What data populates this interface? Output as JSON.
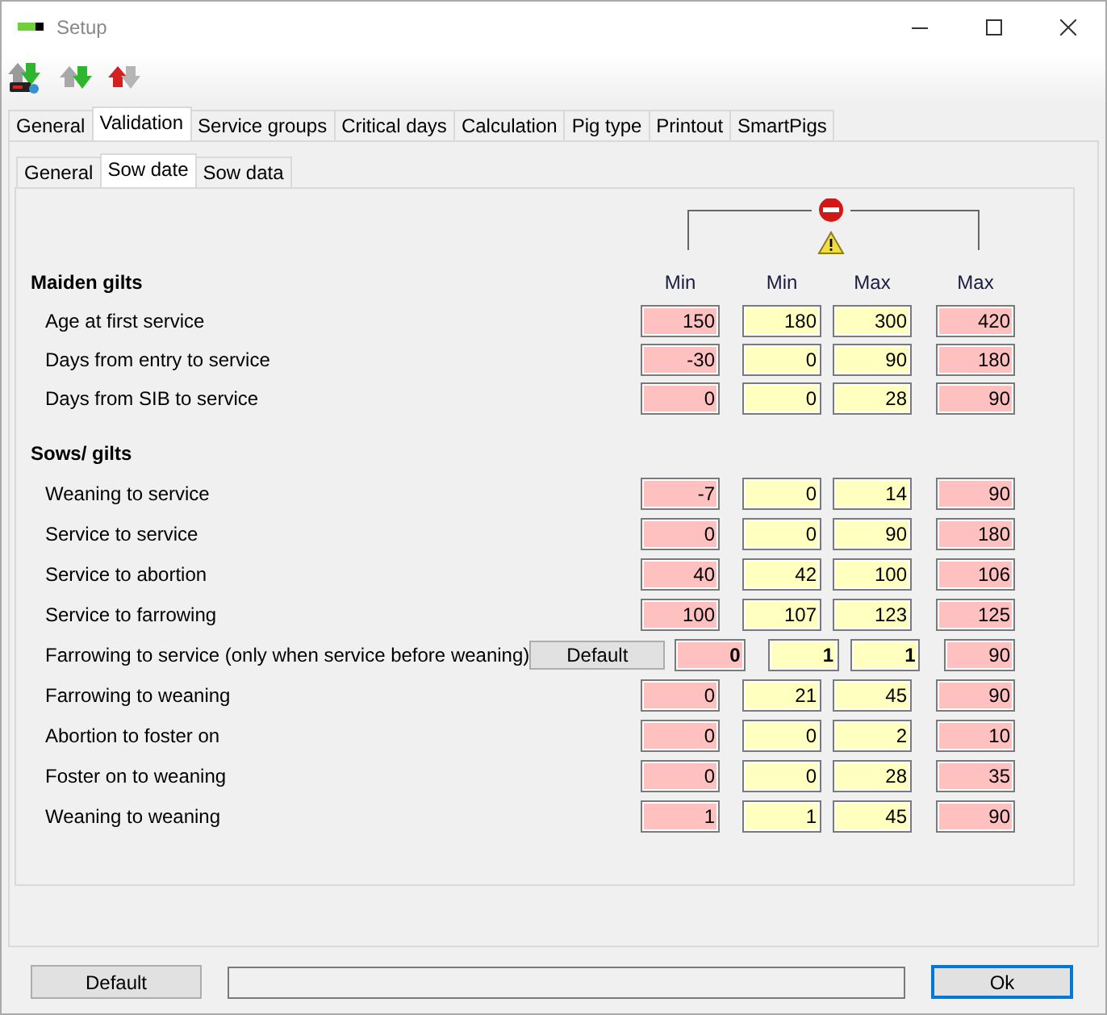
{
  "window": {
    "title": "Setup"
  },
  "tabs": [
    {
      "label": "General",
      "selected": false
    },
    {
      "label": "Validation",
      "selected": true
    },
    {
      "label": "Service groups",
      "selected": false
    },
    {
      "label": "Critical days",
      "selected": false
    },
    {
      "label": "Calculation",
      "selected": false
    },
    {
      "label": "Pig type",
      "selected": false
    },
    {
      "label": "Printout",
      "selected": false
    },
    {
      "label": "SmartPigs",
      "selected": false
    }
  ],
  "subtabs": [
    {
      "label": "General",
      "selected": false
    },
    {
      "label": "Sow date",
      "selected": true
    },
    {
      "label": "Sow data",
      "selected": false
    }
  ],
  "columns": [
    {
      "label": "Min",
      "kind": "error"
    },
    {
      "label": "Min",
      "kind": "warning"
    },
    {
      "label": "Max",
      "kind": "warning"
    },
    {
      "label": "Max",
      "kind": "error"
    }
  ],
  "sections": [
    {
      "title": "Maiden gilts",
      "rows": [
        {
          "label": "Age at first service",
          "values": [
            "150",
            "180",
            "300",
            "420"
          ]
        },
        {
          "label": "Days from entry to service",
          "values": [
            "-30",
            "0",
            "90",
            "180"
          ]
        },
        {
          "label": "Days from SIB to service",
          "values": [
            "0",
            "0",
            "28",
            "90"
          ]
        }
      ]
    },
    {
      "title": "Sows/ gilts",
      "rows": [
        {
          "label": "Weaning to service",
          "values": [
            "-7",
            "0",
            "14",
            "90"
          ]
        },
        {
          "label": "Service to service",
          "values": [
            "0",
            "0",
            "90",
            "180"
          ]
        },
        {
          "label": "Service to abortion",
          "values": [
            "40",
            "42",
            "100",
            "106"
          ]
        },
        {
          "label": "Service to farrowing",
          "values": [
            "100",
            "107",
            "123",
            "125"
          ]
        },
        {
          "label": "Farrowing to service (only when service before weaning)",
          "button": "Default",
          "values": [
            "0",
            "1",
            "1",
            "90"
          ],
          "bold": [
            true,
            true,
            true,
            false
          ]
        },
        {
          "label": "Farrowing to weaning",
          "values": [
            "0",
            "21",
            "45",
            "90"
          ]
        },
        {
          "label": "Abortion to foster on",
          "values": [
            "0",
            "0",
            "2",
            "10"
          ]
        },
        {
          "label": "Foster on to weaning",
          "values": [
            "0",
            "0",
            "28",
            "35"
          ]
        },
        {
          "label": "Weaning to weaning",
          "values": [
            "1",
            "1",
            "45",
            "90"
          ]
        }
      ]
    }
  ],
  "footer": {
    "buttons": [
      {
        "label": "Default",
        "focused": false
      },
      {
        "label": "Ok",
        "focused": true
      }
    ]
  }
}
